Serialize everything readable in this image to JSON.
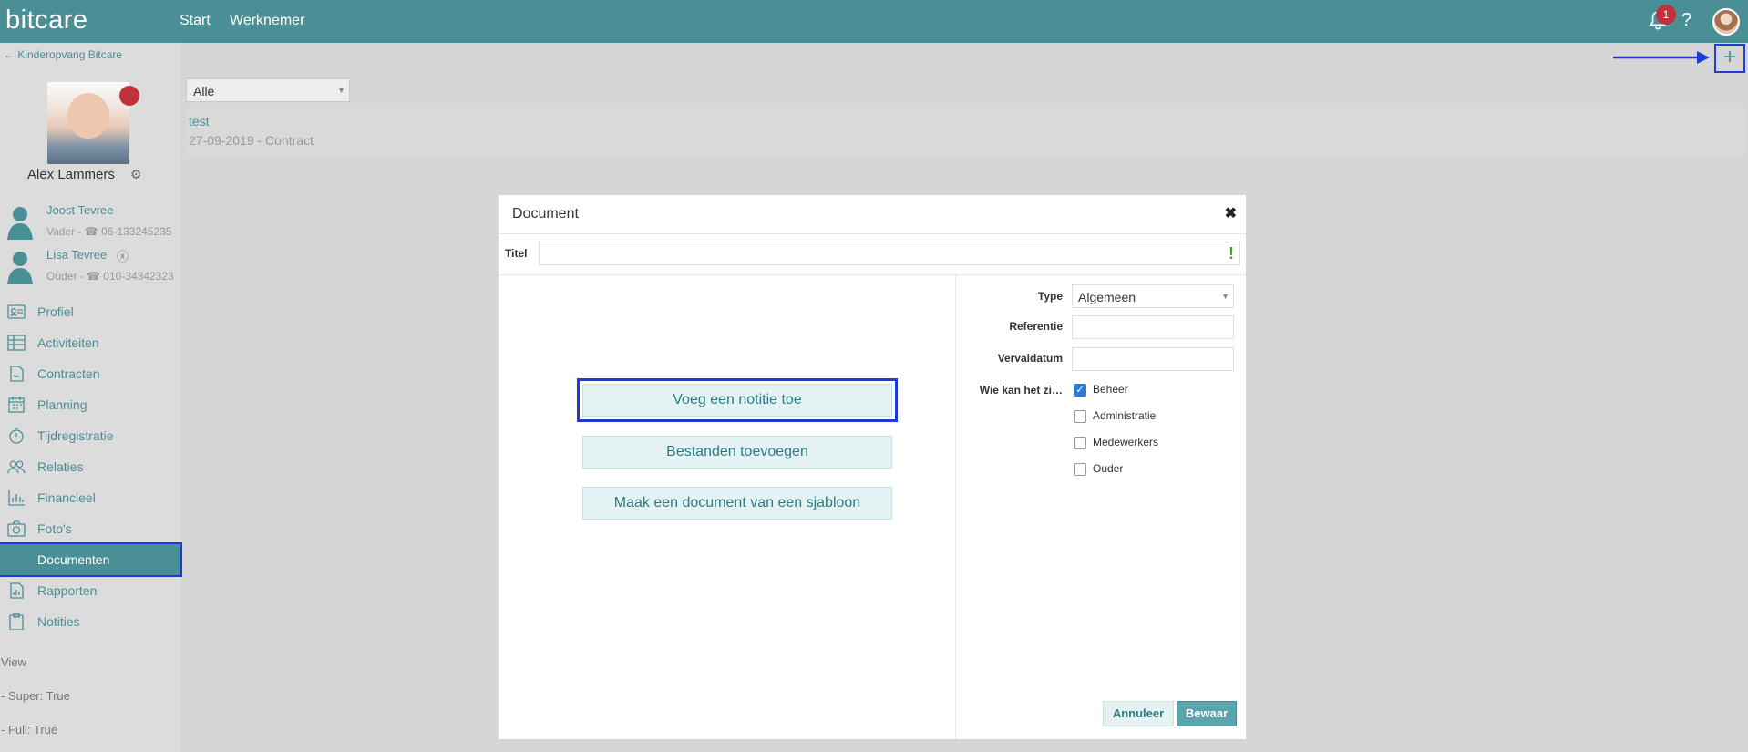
{
  "app": {
    "logo": "bitcare"
  },
  "topnav": {
    "start": "Start",
    "werknemer": "Werknemer"
  },
  "topbar": {
    "notification_count": "1",
    "help": "?"
  },
  "sidebar": {
    "back_link": "← Kinderopvang Bitcare",
    "child_name": "Alex Lammers",
    "contacts": [
      {
        "name": "Joost Tevree",
        "info": "Vader - ☎ 06-133245235"
      },
      {
        "name": "Lisa Tevree",
        "info": "Ouder - ☎ 010-34342323"
      }
    ],
    "nav": [
      {
        "label": "Profiel",
        "icon": "id-card-icon"
      },
      {
        "label": "Activiteiten",
        "icon": "table-icon"
      },
      {
        "label": "Contracten",
        "icon": "contract-icon"
      },
      {
        "label": "Planning",
        "icon": "calendar-icon"
      },
      {
        "label": "Tijdregistratie",
        "icon": "stopwatch-icon"
      },
      {
        "label": "Relaties",
        "icon": "people-icon"
      },
      {
        "label": "Financieel",
        "icon": "bar-chart-icon"
      },
      {
        "label": "Foto's",
        "icon": "camera-icon"
      },
      {
        "label": "Documenten",
        "icon": "folders-icon"
      },
      {
        "label": "Rapporten",
        "icon": "report-icon"
      },
      {
        "label": "Notities",
        "icon": "clipboard-icon"
      }
    ],
    "active_nav": "Documenten",
    "debug": {
      "view": "View",
      "super": "- Super: True",
      "full": "- Full: True"
    }
  },
  "main": {
    "add_button": "+",
    "filter": {
      "selected": "Alle"
    },
    "documents": [
      {
        "title": "test",
        "meta": "27-09-2019 - Contract"
      }
    ]
  },
  "modal": {
    "title": "Document",
    "close": "✖",
    "title_field_label": "Titel",
    "title_field_value": "",
    "title_field_warning": "!",
    "actions": {
      "add_note": "Voeg een notitie toe",
      "add_files": "Bestanden toevoegen",
      "from_template": "Maak een document van een sjabloon"
    },
    "fields": {
      "type_label": "Type",
      "type_value": "Algemeen",
      "reference_label": "Referentie",
      "reference_value": "",
      "expiry_label": "Vervaldatum",
      "expiry_value": "",
      "visibility_label": "Wie kan het zi…"
    },
    "visibility": [
      {
        "label": "Beheer",
        "checked": true
      },
      {
        "label": "Administratie",
        "checked": false
      },
      {
        "label": "Medewerkers",
        "checked": false
      },
      {
        "label": "Ouder",
        "checked": false
      }
    ],
    "buttons": {
      "cancel": "Annuleer",
      "save": "Bewaar"
    }
  }
}
